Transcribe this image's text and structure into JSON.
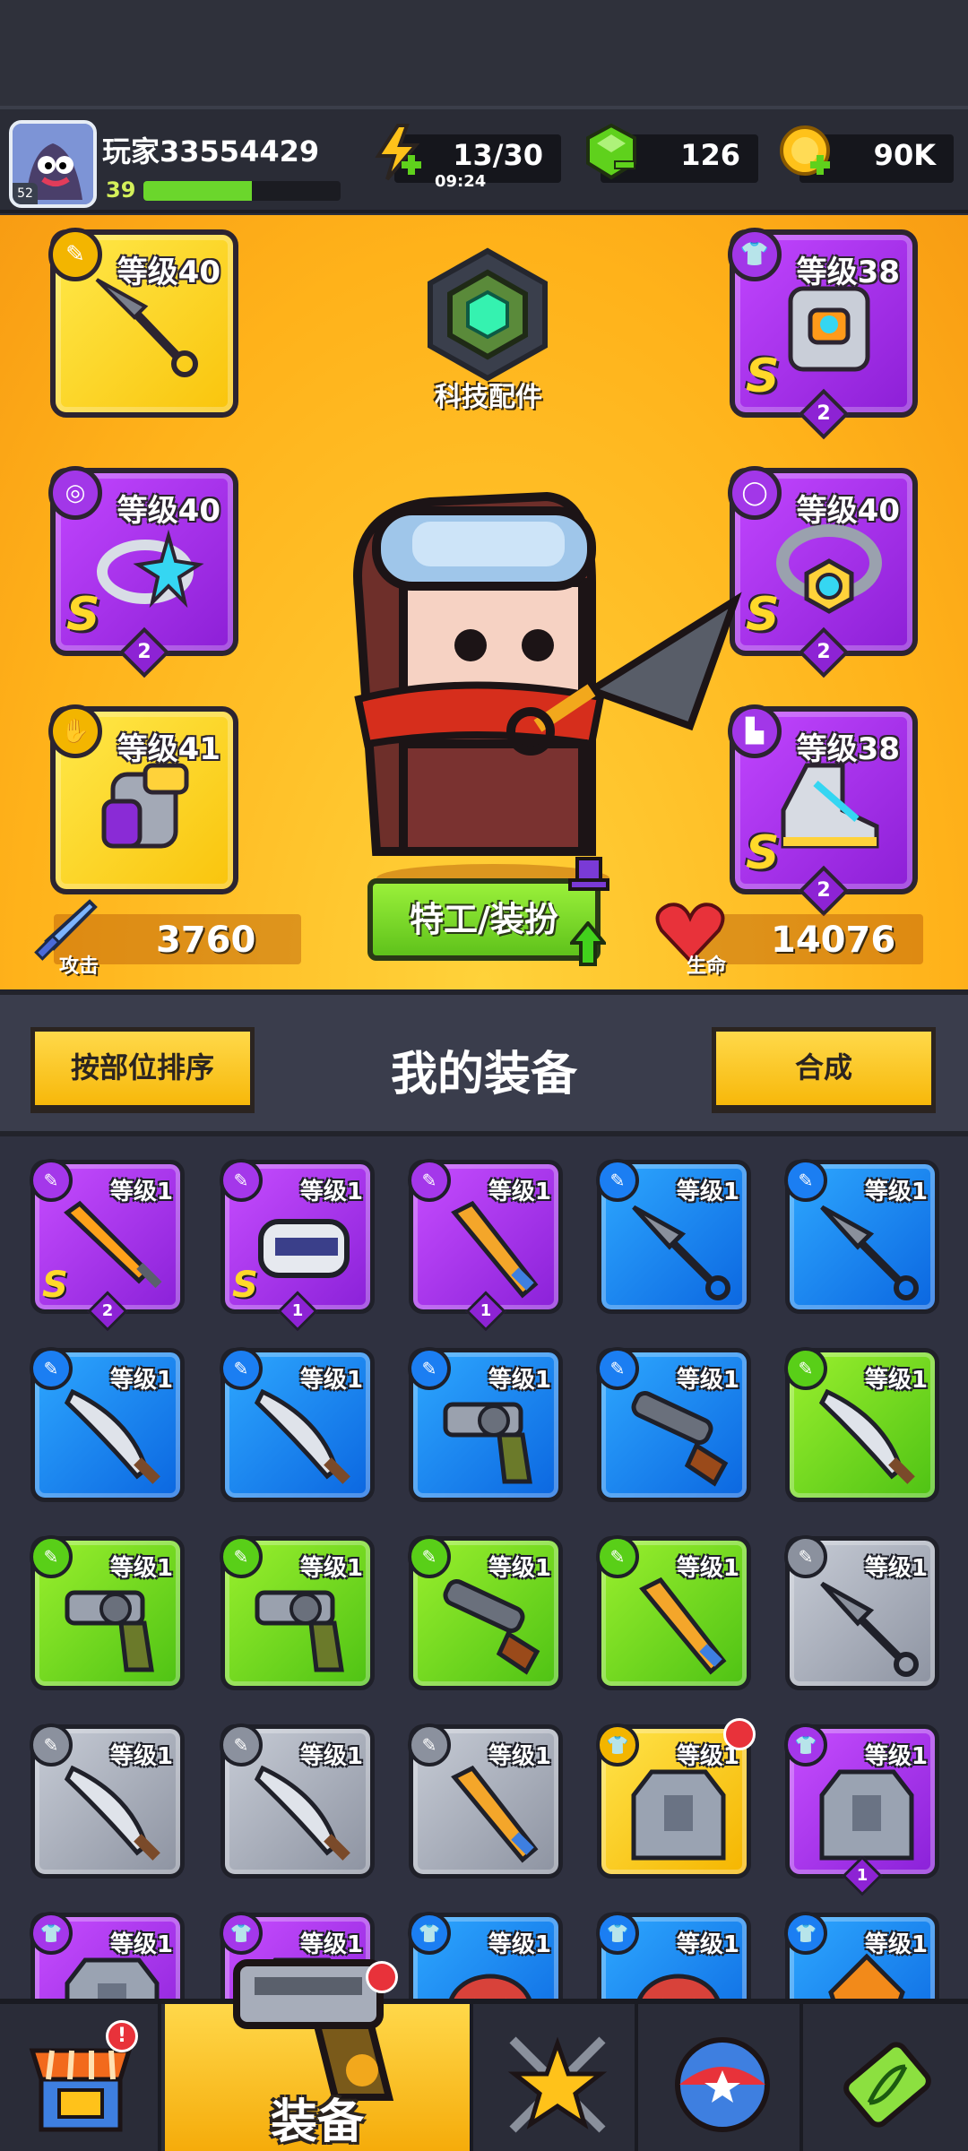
{
  "header": {
    "player_name": "玩家33554429",
    "player_level": "39",
    "avatar_badge": "52",
    "xp_fraction": 0.55,
    "energy": "13/30",
    "energy_timer": "09:24",
    "gems": "126",
    "gold": "90K"
  },
  "hero": {
    "tech_label": "科技配件",
    "attack_label": "攻击",
    "attack_value": "3760",
    "hp_label": "生命",
    "hp_value": "14076",
    "costume_button": "特工/装扮",
    "slots": [
      {
        "level": "等级40",
        "rank": "",
        "count": ""
      },
      {
        "level": "等级38",
        "rank": "S",
        "count": "2"
      },
      {
        "level": "等级40",
        "rank": "S",
        "count": "2"
      },
      {
        "level": "等级40",
        "rank": "S",
        "count": "2"
      },
      {
        "level": "等级41",
        "rank": "",
        "count": ""
      },
      {
        "level": "等级38",
        "rank": "S",
        "count": "2"
      }
    ]
  },
  "inventory": {
    "sort_button": "按部位排序",
    "title": "我的装备",
    "merge_button": "合成",
    "items": [
      {
        "level": "等级1",
        "rank": "S",
        "count": "2"
      },
      {
        "level": "等级1",
        "rank": "S",
        "count": "1"
      },
      {
        "level": "等级1",
        "rank": "",
        "count": "1"
      },
      {
        "level": "等级1",
        "rank": "",
        "count": ""
      },
      {
        "level": "等级1",
        "rank": "",
        "count": ""
      },
      {
        "level": "等级1",
        "rank": "",
        "count": ""
      },
      {
        "level": "等级1",
        "rank": "",
        "count": ""
      },
      {
        "level": "等级1",
        "rank": "",
        "count": ""
      },
      {
        "level": "等级1",
        "rank": "",
        "count": ""
      },
      {
        "level": "等级1",
        "rank": "",
        "count": ""
      },
      {
        "level": "等级1",
        "rank": "",
        "count": ""
      },
      {
        "level": "等级1",
        "rank": "",
        "count": ""
      },
      {
        "level": "等级1",
        "rank": "",
        "count": ""
      },
      {
        "level": "等级1",
        "rank": "",
        "count": ""
      },
      {
        "level": "等级1",
        "rank": "",
        "count": ""
      },
      {
        "level": "等级1",
        "rank": "",
        "count": ""
      },
      {
        "level": "等级1",
        "rank": "",
        "count": ""
      },
      {
        "level": "等级1",
        "rank": "",
        "count": ""
      },
      {
        "level": "等级1",
        "rank": "",
        "count": ""
      },
      {
        "level": "等级1",
        "rank": "",
        "count": "1"
      },
      {
        "level": "等级1",
        "rank": "",
        "count": ""
      },
      {
        "level": "等级1",
        "rank": "",
        "count": ""
      },
      {
        "level": "等级1",
        "rank": "",
        "count": ""
      },
      {
        "level": "等级1",
        "rank": "",
        "count": ""
      },
      {
        "level": "等级1",
        "rank": "",
        "count": ""
      }
    ]
  },
  "nav": {
    "equipment_label": "装备",
    "shop_alert": "!"
  },
  "colors": {
    "rarity_purple": "#a437ea",
    "rarity_blue": "#1b7ef2",
    "rarity_green": "#59cf18",
    "rarity_gray": "#8b919e",
    "rarity_gold": "#f3b500",
    "accent_yellow": "#ffd84a"
  },
  "icons": [
    "weapon-icon",
    "armor-icon",
    "ring-icon",
    "necklace-icon",
    "glove-icon",
    "boot-icon",
    "energy-icon",
    "gem-icon",
    "gold-coin-icon",
    "shop-icon",
    "battle-icon",
    "gacha-icon",
    "dna-icon"
  ]
}
